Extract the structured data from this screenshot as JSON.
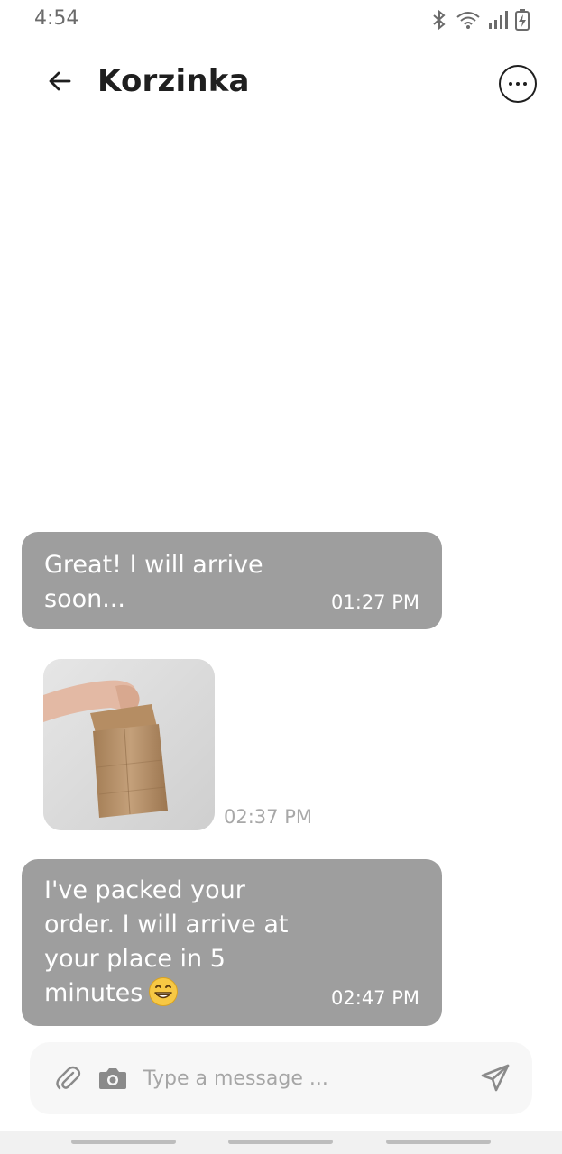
{
  "status_bar": {
    "time": "4:54",
    "icons": [
      "bluetooth-icon",
      "wifi-icon",
      "signal-icon",
      "battery-charging-icon"
    ]
  },
  "header": {
    "title": "Korzinka",
    "back_icon": "arrow-left-icon",
    "more_icon": "more-horizontal-icon"
  },
  "messages": [
    {
      "type": "text",
      "text": "Great! I will arrive soon...",
      "time": "01:27 PM"
    },
    {
      "type": "image",
      "image_desc": "hand-holding-paper-bag",
      "time": "02:37 PM"
    },
    {
      "type": "text",
      "text": "I've packed your order. I will arrive at your place in 5 minutes",
      "emoji": "grinning-face",
      "time": "02:47 PM"
    }
  ],
  "composer": {
    "placeholder": "Type a message ...",
    "attach_icon": "paperclip-icon",
    "camera_icon": "camera-icon",
    "send_icon": "send-icon"
  },
  "colors": {
    "bubble": "#9e9e9e",
    "title": "#1f1f1f",
    "input_bg": "#f7f7f7"
  }
}
